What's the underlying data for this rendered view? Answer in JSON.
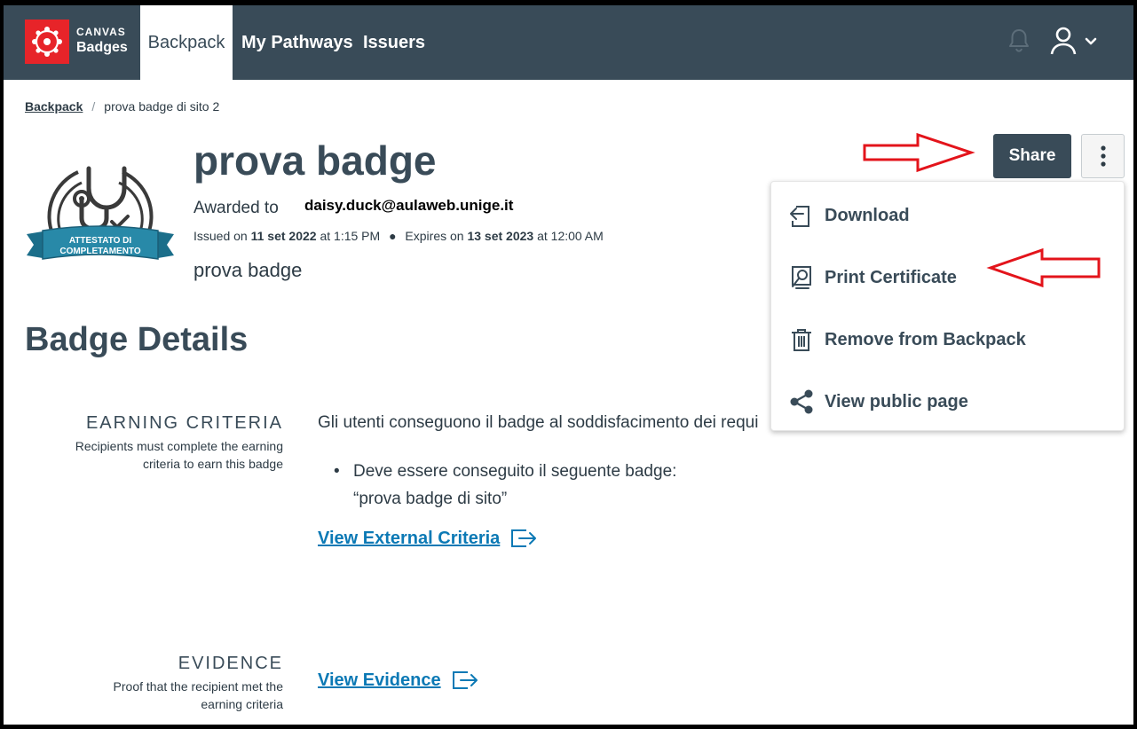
{
  "nav": {
    "logo_line1": "CANVAS",
    "logo_line2": "Badges",
    "tabs": [
      {
        "label": "Backpack",
        "active": true
      },
      {
        "label": "My Pathways",
        "active": false
      },
      {
        "label": "Issuers",
        "active": false
      }
    ],
    "icons": [
      "bell-icon",
      "user-icon",
      "chevron-down-icon"
    ]
  },
  "breadcrumb": {
    "root": "Backpack",
    "separator": "/",
    "current": "prova badge di sito 2"
  },
  "badge": {
    "image_ribbon_line1": "ATTESTATO DI",
    "image_ribbon_line2": "COMPLETAMENTO",
    "title": "prova badge",
    "awarded_label": "Awarded to",
    "awarded_email": "daisy.duck@aulaweb.unige.it",
    "issued_label": "Issued on",
    "issued_date": "11 set 2022",
    "issued_at": "at 1:15 PM",
    "expires_label": "Expires on",
    "expires_date": "13 set 2023",
    "expires_at": "at 12:00 AM",
    "description": "prova badge"
  },
  "actions": {
    "share_label": "Share",
    "more_icon": "more-vertical-icon"
  },
  "menu": {
    "items": [
      {
        "label": "Download",
        "icon": "download-icon"
      },
      {
        "label": "Print Certificate",
        "icon": "print-certificate-icon"
      },
      {
        "label": "Remove from Backpack",
        "icon": "trash-icon"
      },
      {
        "label": "View public page",
        "icon": "share-icon"
      }
    ]
  },
  "details": {
    "title": "Badge Details",
    "criteria": {
      "heading": "EARNING CRITERIA",
      "sub_line1": "Recipients must complete the earning",
      "sub_line2": "criteria to earn this badge",
      "text": "Gli utenti conseguono il badge al soddisfacimento dei requi",
      "bullet_line1": "Deve essere conseguito il seguente badge:",
      "bullet_line2": "“prova badge di sito”",
      "link": "View External Criteria"
    },
    "evidence": {
      "heading": "EVIDENCE",
      "sub_line1": "Proof that the recipient met the",
      "sub_line2": "earning criteria",
      "link": "View Evidence"
    }
  },
  "colors": {
    "nav_bg": "#394b58",
    "logo_red": "#e72429",
    "link_blue": "#0b79b5",
    "annotation_red": "#e3141b"
  }
}
